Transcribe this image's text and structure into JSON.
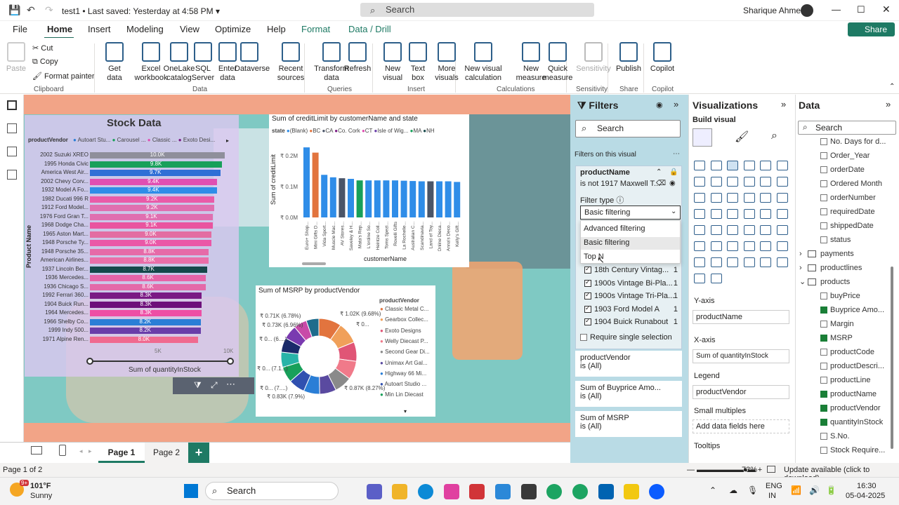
{
  "titlebar": {
    "file": "test1",
    "saved": "• Last saved: Yesterday at 4:58 PM",
    "search": "Search",
    "user": "Sharique Ahmed",
    "share": "Share"
  },
  "menu": [
    "File",
    "Home",
    "Insert",
    "Modeling",
    "View",
    "Optimize",
    "Help",
    "Format",
    "Data / Drill"
  ],
  "ribbon": {
    "clipboard": {
      "paste": "Paste",
      "cut": "Cut",
      "copy": "Copy",
      "format_painter": "Format painter",
      "label": "Clipboard"
    },
    "data": {
      "items": [
        "Get\ndata",
        "Excel\nworkbook",
        "OneLake\ncatalog",
        "SQL\nServer",
        "Enter\ndata",
        "Dataverse",
        "Recent\nsources"
      ],
      "label": "Data"
    },
    "queries": {
      "items": [
        "Transform\ndata",
        "Refresh"
      ],
      "label": "Queries"
    },
    "insert": {
      "items": [
        "New\nvisual",
        "Text\nbox",
        "More\nvisuals"
      ],
      "label": "Insert"
    },
    "calc": {
      "items": [
        "New visual\ncalculation",
        "New\nmeasure",
        "Quick\nmeasure"
      ],
      "label": "Calculations"
    },
    "sens": {
      "items": [
        "Sensitivity"
      ],
      "label": "Sensitivity"
    },
    "share": {
      "items": [
        "Publish"
      ],
      "label": "Share"
    },
    "copilot": {
      "items": [
        "Copilot"
      ],
      "label": "Copilot"
    }
  },
  "stock": {
    "title": "Stock Data",
    "legend_label": "productVendor",
    "legend": [
      "Autoart Stu...",
      "Carousel ...",
      "Classic ...",
      "Exoto Desi..."
    ],
    "axis_y": "Product Name",
    "axis_x": "Sum of quantityInStock",
    "ticks": [
      "5K",
      "10K"
    ]
  },
  "chart_data": [
    {
      "type": "bar",
      "title": "Stock Data",
      "orientation": "horizontal",
      "xlabel": "Sum of quantityInStock",
      "ylabel": "Product Name",
      "categories": [
        "2002 Suzuki XREO",
        "1995 Honda Civic",
        "America West Air...",
        "2002 Chevy Corv...",
        "1932 Model A Fo...",
        "1982 Ducati 996 R",
        "1912 Ford Model...",
        "1976 Ford Gran T...",
        "1968 Dodge Cha...",
        "1965 Aston Mart...",
        "1948 Porsche Ty...",
        "1948 Porsche 35...",
        "American Airlines...",
        "1937 Lincoln Ber...",
        "1936 Mercedes...",
        "1936 Chicago S...",
        "1992 Ferrari 360...",
        "1904 Buick Run...",
        "1964 Mercedes...",
        "1966 Shelby Co...",
        "1999 Indy 500...",
        "1971 Alpine Ren..."
      ],
      "values": [
        10.0,
        9.8,
        9.7,
        9.4,
        9.4,
        9.2,
        9.2,
        9.1,
        9.1,
        9.0,
        9.0,
        8.8,
        8.8,
        8.7,
        8.6,
        8.6,
        8.3,
        8.3,
        8.3,
        8.2,
        8.2,
        8.0
      ],
      "labels": [
        "10.0K",
        "9.8K",
        "9.7K",
        "9.4K",
        "9.4K",
        "9.2K",
        "9.2K",
        "9.1K",
        "9.1K",
        "9.0K",
        "9.0K",
        "8.8K",
        "8.8K",
        "8.7K",
        "8.6K",
        "8.6K",
        "8.3K",
        "8.3K",
        "8.3K",
        "8.2K",
        "8.2K",
        "8.0K"
      ],
      "colors": [
        "#8f8f9b",
        "#18a05a",
        "#2f6fd6",
        "#e04fb2",
        "#2f8de8",
        "#e95ba8",
        "#e06fb0",
        "#e06fb0",
        "#e9549f",
        "#e36da2",
        "#ea58a7",
        "#e66aa8",
        "#ea6ea8",
        "#16484a",
        "#e763a7",
        "#e469a9",
        "#7a1a84",
        "#6d0f7a",
        "#ee4fa5",
        "#2a7ed6",
        "#6a3da9",
        "#f06a8f"
      ]
    },
    {
      "type": "bar",
      "title": "Sum of creditLimit by customerName and state",
      "xlabel": "customerName",
      "ylabel": "Sum of creditLimit",
      "ylim": [
        0,
        0.25
      ],
      "yticks": [
        "₹ 0.2M",
        "₹ 0.1M",
        "₹ 0.0M"
      ],
      "legend_label": "state",
      "legend": [
        "(Blank)",
        "BC",
        "CA",
        "Co. Cork",
        "CT",
        "Isle of Wig...",
        "MA",
        "NH"
      ],
      "categories": [
        "Euro+ Shop...",
        "Mini Gifts D...",
        "Vida Sport...",
        "Muscle Mac...",
        "AV Stores...",
        "Saveley & H...",
        "Mata's Rep...",
        "L'ordine So...",
        "Heintze Coll...",
        "Toms Spezi...",
        "Rovelli Gifts",
        "La Rochelle...",
        "Australian C...",
        "Scandinavia...",
        "Land of Toy...",
        "Online Dieca...",
        "Anna's Deco...",
        "Kelly's Gift..."
      ],
      "values": [
        0.227,
        0.21,
        0.138,
        0.13,
        0.127,
        0.125,
        0.12,
        0.12,
        0.12,
        0.12,
        0.12,
        0.119,
        0.118,
        0.117,
        0.117,
        0.117,
        0.117,
        0.115
      ],
      "colors": [
        "#2f8de8",
        "#e2743e",
        "#2f8de8",
        "#2f8de8",
        "#4a5568",
        "#2f8de8",
        "#18a05a",
        "#2f8de8",
        "#2f8de8",
        "#2f8de8",
        "#2f8de8",
        "#2f8de8",
        "#2f8de8",
        "#2f8de8",
        "#4a5568",
        "#2f8de8",
        "#2f8de8",
        "#2f8de8"
      ]
    },
    {
      "type": "pie",
      "title": "Sum of MSRP by productVendor",
      "legend_label": "productVendor",
      "legend": [
        "Classic Metal C...",
        "Gearbox Collec...",
        "Exoto Designs",
        "Welly Diecast P...",
        "Second Gear Di...",
        "Unimax Art Gal...",
        "Highway 66 Mi...",
        "Autoart Studio ...",
        "Min Lin Diecast"
      ],
      "slice_labels": [
        "₹ 1.02K (9.68%)",
        "₹ 0...",
        "₹ 0.87K (8.27%)",
        "₹ 0.83K (7.9%)",
        "₹ 0... (7....)",
        "₹ 0... (7.1...)",
        "₹ 0... (6....)",
        "₹ 0.73K (6.96%)",
        "₹ 0.71K (6.78%)"
      ],
      "values": [
        9.68,
        9.2,
        8.27,
        7.9,
        7.5,
        7.1,
        6.9,
        6.96,
        6.78,
        6.5,
        6.2,
        6.0,
        5.6,
        5.4
      ],
      "colors": [
        "#e2743e",
        "#f0a05a",
        "#e05576",
        "#f07a8a",
        "#8a8a8a",
        "#5a4aa0",
        "#2a7ed6",
        "#3050b0",
        "#18a05a",
        "#28b4a8",
        "#1a2a6a",
        "#7a3ab0",
        "#c84aa8",
        "#1e6c8c"
      ]
    }
  ],
  "filters": {
    "title": "Filters",
    "search": "Search",
    "on_visual": "Filters on this visual",
    "field": "productName",
    "condition": "is not 1917 Maxwell T...",
    "filter_type_label": "Filter type",
    "selected": "Basic filtering",
    "options": [
      "Advanced filtering",
      "Basic filtering",
      "Top N"
    ],
    "list": [
      {
        "name": "18th Century Vintag...",
        "count": "1"
      },
      {
        "name": "1900s Vintage Bi-Pla...",
        "count": "1"
      },
      {
        "name": "1900s Vintage Tri-Pla...",
        "count": "1"
      },
      {
        "name": "1903 Ford Model A",
        "count": "1"
      },
      {
        "name": "1904 Buick Runabout",
        "count": "1"
      }
    ],
    "require_single": "Require single selection",
    "cards": [
      {
        "name": "productVendor",
        "val": "is (All)"
      },
      {
        "name": "Sum of Buyprice Amo...",
        "val": "is (All)"
      },
      {
        "name": "Sum of MSRP",
        "val": "is (All)"
      }
    ]
  },
  "viz": {
    "title": "Visualizations",
    "build": "Build visual",
    "yaxis": "Y-axis",
    "yfield": "productName",
    "xaxis": "X-axis",
    "xfield": "Sum of quantityInStock",
    "legend": "Legend",
    "legend_field": "productVendor",
    "small": "Small multiples",
    "add": "Add data fields here",
    "tooltips": "Tooltips"
  },
  "data": {
    "title": "Data",
    "search": "Search",
    "rows": [
      {
        "t": "No. Days for d...",
        "c": false,
        "i": 1
      },
      {
        "t": "Order_Year",
        "c": false,
        "i": 1
      },
      {
        "t": "orderDate",
        "c": false,
        "i": 1
      },
      {
        "t": "Ordered Month",
        "c": false,
        "i": 1
      },
      {
        "t": "orderNumber",
        "c": false,
        "i": 1
      },
      {
        "t": "requiredDate",
        "c": false,
        "i": 1
      },
      {
        "t": "shippedDate",
        "c": false,
        "i": 1
      },
      {
        "t": "status",
        "c": false,
        "i": 1
      },
      {
        "t": "payments",
        "c": false,
        "i": 0
      },
      {
        "t": "productlines",
        "c": false,
        "i": 0
      },
      {
        "t": "products",
        "c": false,
        "i": 0
      },
      {
        "t": "buyPrice",
        "c": false,
        "i": 1
      },
      {
        "t": "Buyprice Amo...",
        "c": true,
        "i": 1
      },
      {
        "t": "Margin",
        "c": false,
        "i": 1
      },
      {
        "t": "MSRP",
        "c": true,
        "i": 1
      },
      {
        "t": "productCode",
        "c": false,
        "i": 1
      },
      {
        "t": "productDescri...",
        "c": false,
        "i": 1
      },
      {
        "t": "productLine",
        "c": false,
        "i": 1
      },
      {
        "t": "productName",
        "c": true,
        "i": 1
      },
      {
        "t": "productVendor",
        "c": true,
        "i": 1
      },
      {
        "t": "quantityInStock",
        "c": true,
        "i": 1
      },
      {
        "t": "S.No.",
        "c": false,
        "i": 1
      },
      {
        "t": "Stock Require...",
        "c": false,
        "i": 1
      }
    ]
  },
  "pages": {
    "page1": "Page 1",
    "page2": "Page 2",
    "add": "+",
    "status": "Page 1 of 2",
    "zoom": "73%",
    "update": "Update available (click to download)"
  },
  "taskbar": {
    "temp": "101°F",
    "weather": "Sunny",
    "search": "Search",
    "lang": "ENG",
    "region": "IN",
    "time": "16:30",
    "date": "05-04-2025",
    "badge": "9+"
  }
}
